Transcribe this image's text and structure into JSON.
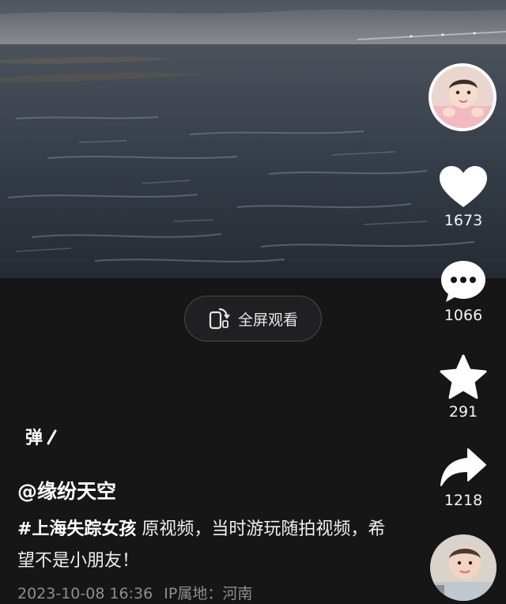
{
  "video": {
    "fullscreen_label": "全屏观看"
  },
  "overlay": {
    "danmu_label": "弹"
  },
  "post": {
    "author": "@缘纷天空",
    "hashtag": "#上海失踪女孩",
    "caption": " 原视频，当时游玩随拍视频，希望不是小朋友！",
    "datetime": "2023-10-08 16:36",
    "ip_location": "IP属地：河南"
  },
  "actions": {
    "likes": "1673",
    "comments": "1066",
    "favorites": "291",
    "shares": "1218"
  },
  "icons": {
    "fullscreen": "phone-rotate-icon",
    "like": "heart-icon",
    "comment": "speech-bubble-icon",
    "favorite": "star-icon",
    "share": "share-arrow-icon",
    "danmu": "danmu-icon"
  },
  "colors": {
    "background": "#161617",
    "meta_text": "#8e8e92",
    "icon": "#ffffff"
  }
}
